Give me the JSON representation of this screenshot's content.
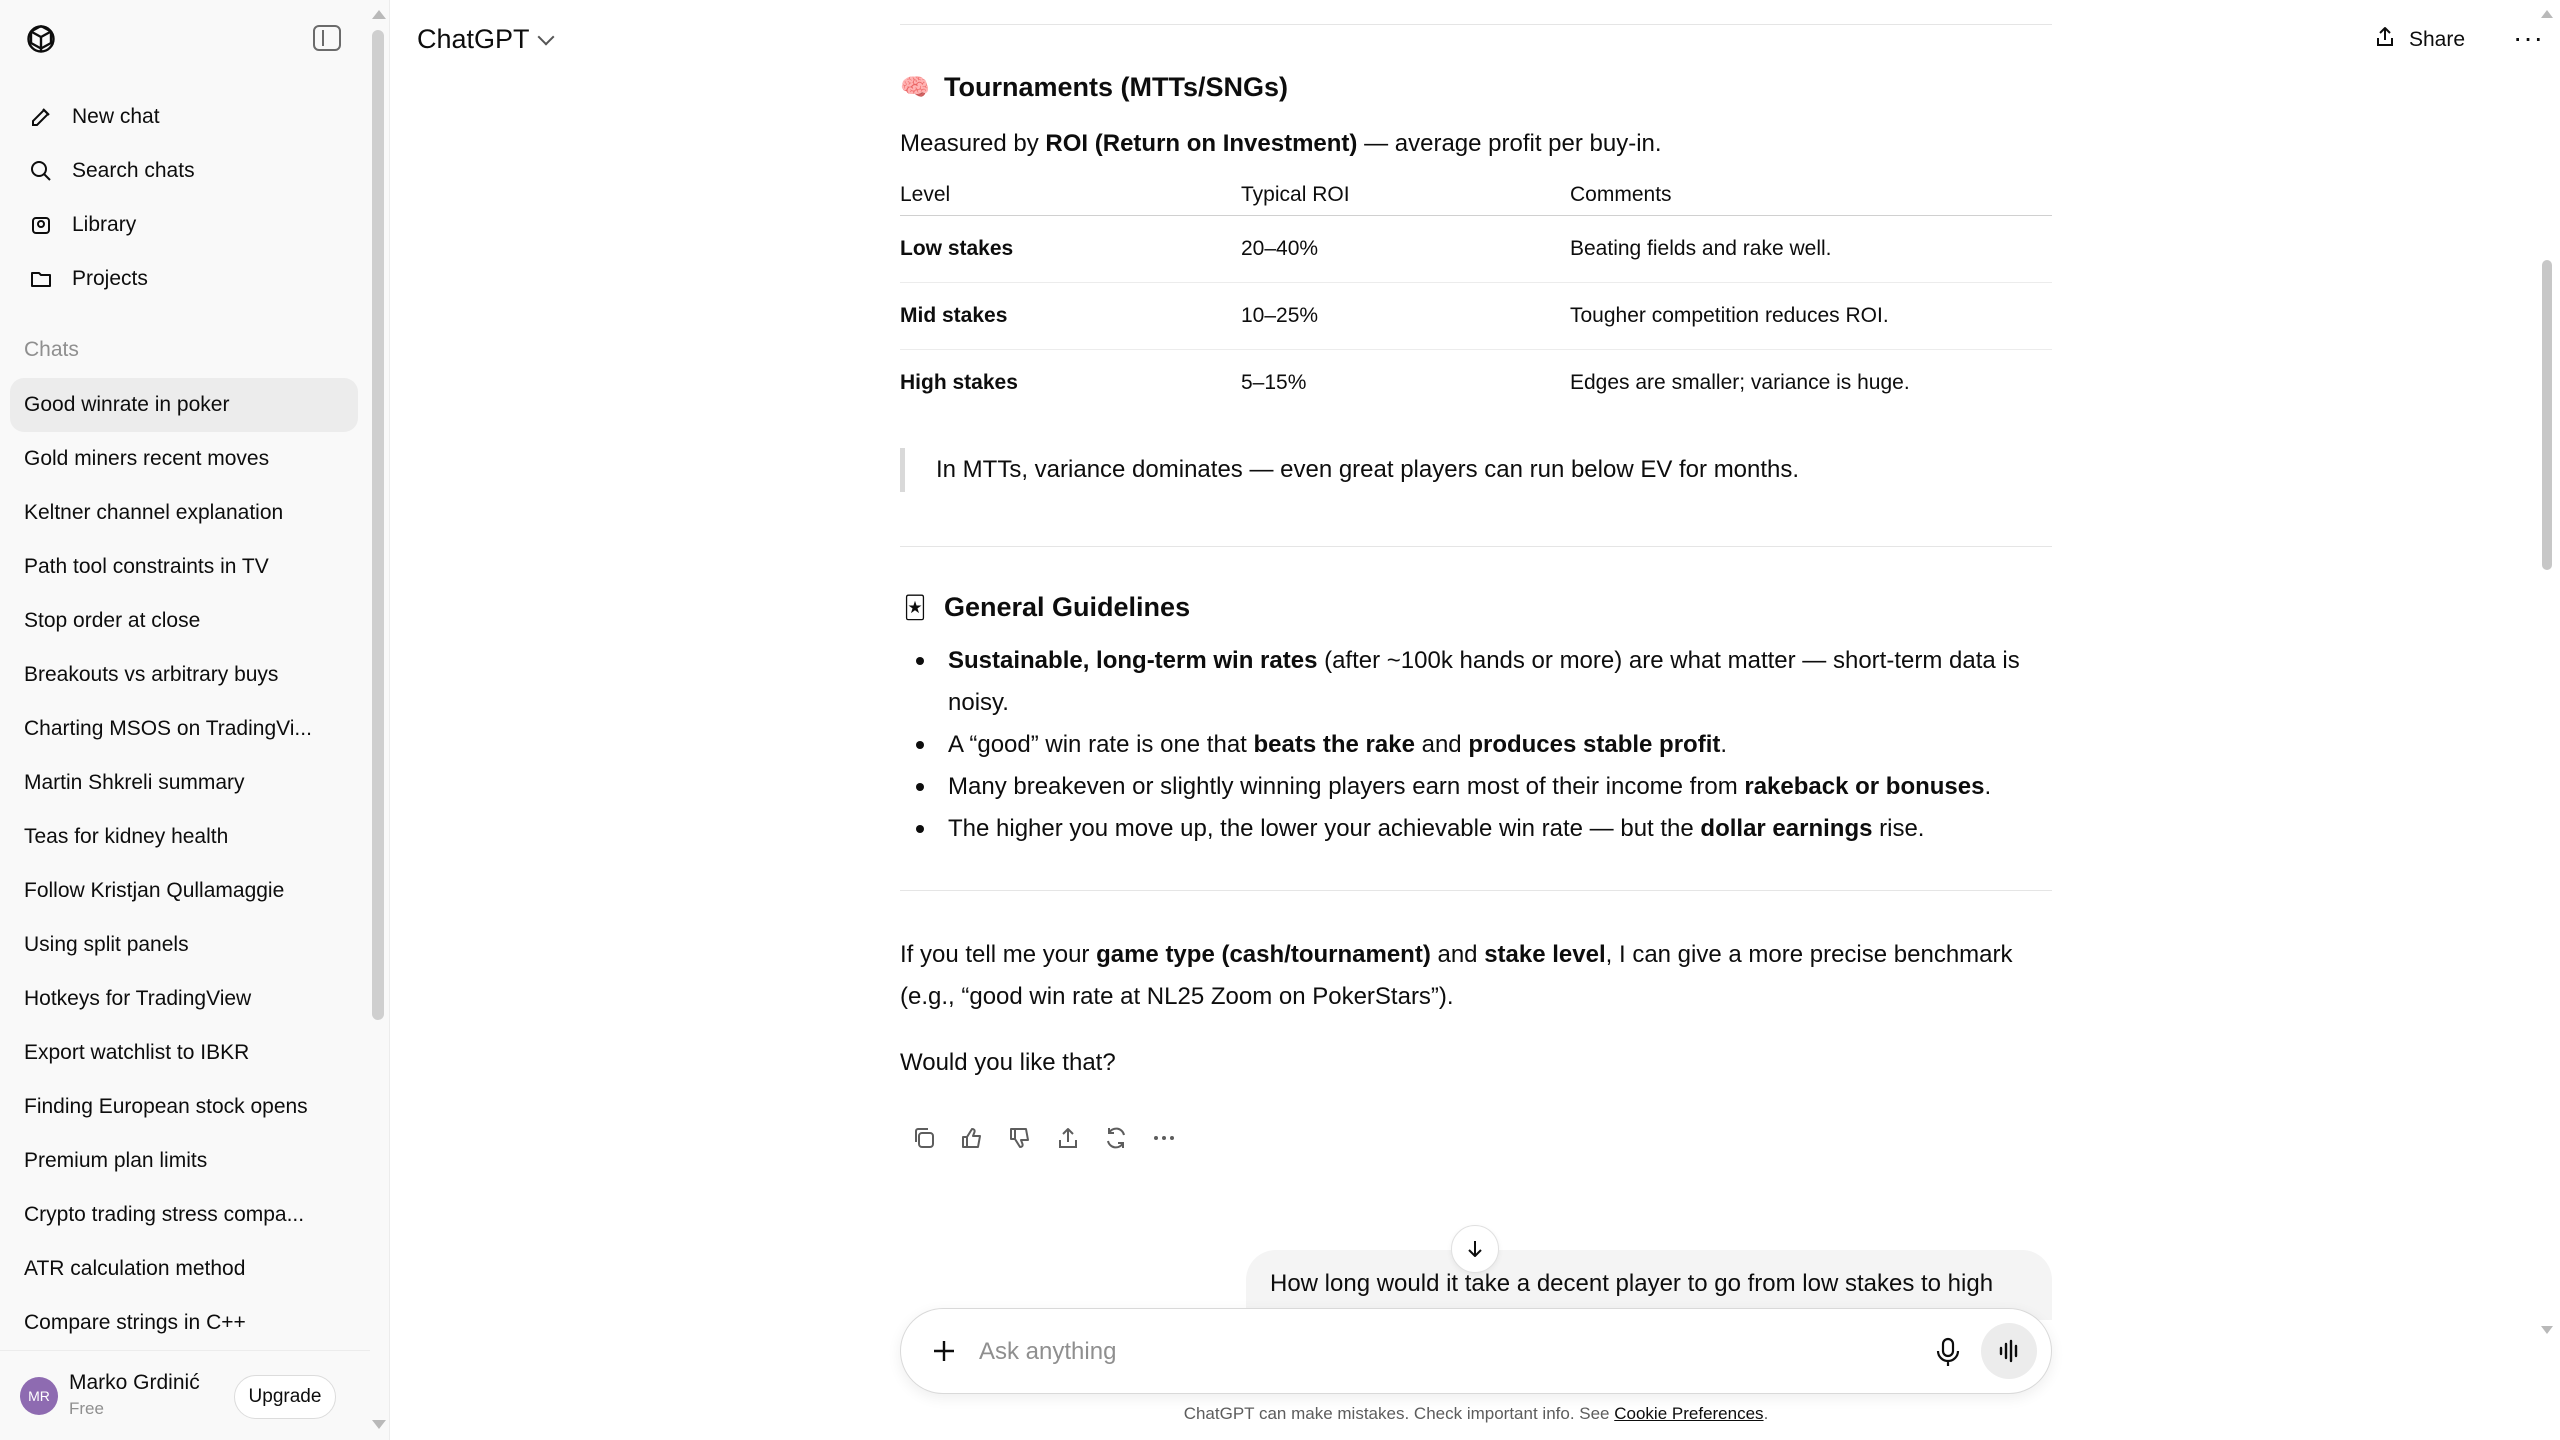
{
  "app": {
    "model_name": "ChatGPT"
  },
  "header": {
    "share_label": "Share",
    "more_label": "···"
  },
  "sidebar": {
    "nav": [
      {
        "label": "New chat",
        "icon": "new-chat-icon"
      },
      {
        "label": "Search chats",
        "icon": "search-icon"
      },
      {
        "label": "Library",
        "icon": "library-icon"
      },
      {
        "label": "Projects",
        "icon": "projects-icon"
      }
    ],
    "chats_label": "Chats",
    "chats": [
      "Good winrate in poker",
      "Gold miners recent moves",
      "Keltner channel explanation",
      "Path tool constraints in TV",
      "Stop order at close",
      "Breakouts vs arbitrary buys",
      "Charting MSOS on TradingVi...",
      "Martin Shkreli summary",
      "Teas for kidney health",
      "Follow Kristjan Qullamaggie",
      "Using split panels",
      "Hotkeys for TradingView",
      "Export watchlist to IBKR",
      "Finding European stock opens",
      "Premium plan limits",
      "Crypto trading stress compa...",
      "ATR calculation method",
      "Compare strings in C++"
    ],
    "active_chat_index": 0,
    "user": {
      "initials": "MR",
      "name": "Marko Grdinić",
      "plan": "Free",
      "upgrade_label": "Upgrade"
    }
  },
  "message": {
    "tournaments": {
      "emoji": "🧠",
      "title": "Tournaments (MTTs/SNGs)",
      "intro_pre": "Measured by ",
      "intro_bold": "ROI (Return on Investment)",
      "intro_post": " — average profit per buy-in.",
      "table": {
        "headers": [
          "Level",
          "Typical ROI",
          "Comments"
        ],
        "rows": [
          [
            "Low stakes",
            "20–40%",
            "Beating fields and rake well."
          ],
          [
            "Mid stakes",
            "10–25%",
            "Tougher competition reduces ROI."
          ],
          [
            "High stakes",
            "5–15%",
            "Edges are smaller; variance is huge."
          ]
        ]
      },
      "quote": "In MTTs, variance dominates — even great players can run below EV for months."
    },
    "guidelines": {
      "emoji": "🃏",
      "title": "General Guidelines",
      "items": [
        {
          "b1": "Sustainable, long-term win rates",
          "t1": " (after ~100k hands or more) are what matter — short-term data is noisy."
        },
        {
          "t0": "A “good” win rate is one that ",
          "b1": "beats the rake",
          "t1": " and ",
          "b2": "produces stable profit",
          "t2": "."
        },
        {
          "t0": "Many breakeven or slightly winning players earn most of their income from ",
          "b1": "rakeback or bonuses",
          "t1": "."
        },
        {
          "t0": "The higher you move up, the lower your achievable win rate — but the ",
          "b1": "dollar earnings",
          "t1": " rise."
        }
      ]
    },
    "closing": {
      "t0": "If you tell me your ",
      "b1": "game type (cash/tournament)",
      "t1": " and ",
      "b2": "stake level",
      "t2": ", I can give a more precise benchmark (e.g., “good win rate at NL25 Zoom on PokerStars”).",
      "question": "Would you like that?"
    },
    "actions": [
      "copy-icon",
      "thumbs-up-icon",
      "thumbs-down-icon",
      "share-icon",
      "regenerate-icon",
      "more-icon"
    ]
  },
  "user_message": "How long would it take a decent player to go from low stakes to high",
  "composer": {
    "placeholder": "Ask anything"
  },
  "footer": {
    "note": "ChatGPT can make mistakes. Check important info. See ",
    "link": "Cookie Preferences",
    "end": "."
  }
}
